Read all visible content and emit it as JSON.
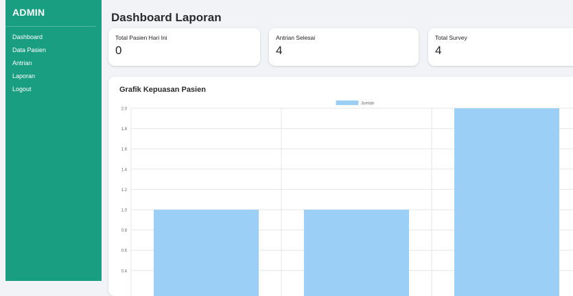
{
  "sidebar": {
    "brand": "ADMIN",
    "items": [
      {
        "label": "Dashboard"
      },
      {
        "label": "Data Pasien"
      },
      {
        "label": "Antrian"
      },
      {
        "label": "Laporan"
      },
      {
        "label": "Logout"
      }
    ]
  },
  "main": {
    "title": "Dashboard Laporan",
    "cards": [
      {
        "label": "Total Pasien Hari Ini",
        "value": "0"
      },
      {
        "label": "Antrian Selesai",
        "value": "4"
      },
      {
        "label": "Total Survey",
        "value": "4"
      }
    ],
    "chart_panel": {
      "title": "Grafik Kepuasan Pasien"
    }
  },
  "colors": {
    "sidebar": "#1a9e82",
    "bar": "#9ccff5",
    "page_bg": "#f1f3f6"
  },
  "chart_data": {
    "type": "bar",
    "title": "Grafik Kepuasan Pasien",
    "categories": [
      "",
      "",
      ""
    ],
    "series": [
      {
        "name": "Jumlah",
        "values": [
          1,
          1,
          2
        ]
      }
    ],
    "yticks": [
      "2.0",
      "1.8",
      "1.6",
      "1.4",
      "1.2",
      "1.0",
      "0.8",
      "0.6",
      "0.4"
    ],
    "ylim": [
      0,
      2
    ],
    "grid": true,
    "legend": "top-center"
  }
}
